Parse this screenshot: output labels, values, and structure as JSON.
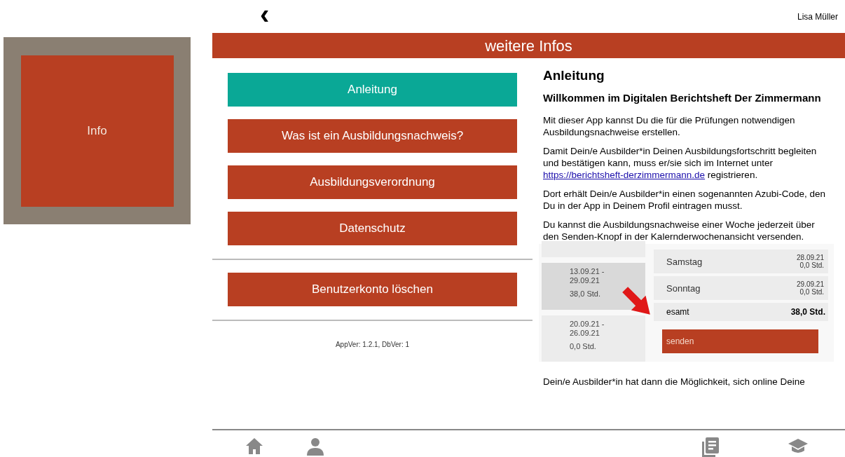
{
  "tile": {
    "label": "Info"
  },
  "top_bar": {
    "back": "‹",
    "user": "Lisa Müller"
  },
  "header": {
    "title": "weitere Infos"
  },
  "menu": [
    {
      "label": "Anleitung",
      "selected": true
    },
    {
      "label": "Was ist ein Ausbildungsnachweis?",
      "selected": false
    },
    {
      "label": "Ausbildungsverordnung",
      "selected": false
    },
    {
      "label": "Datenschutz",
      "selected": false
    }
  ],
  "delete_button": "Benutzerkonto löschen",
  "version": "AppVer: 1.2.1, DbVer: 1",
  "article": {
    "title": "Anleitung",
    "subtitle": "Willkommen im Digitalen Berichtsheft Der Zimmermann",
    "paragraphs": [
      {
        "text": "Mit dieser App kannst Du die für die Prüfungen notwendigen Ausbildungsnachweise erstellen."
      },
      {
        "text": "Damit Dein/e Ausbilder*in Deinen Ausbildungsfortschritt begleiten und bestätigen kann, muss er/sie sich im Internet unter",
        "link": "https://berichtsheft-derzimmermann.de",
        "after": "registrieren."
      },
      {
        "text": "Dort erhält Dein/e Ausbilder*in einen sogenannten Azubi-Code, den Du in der App in Deinem Profil eintragen musst."
      },
      {
        "text": "Du kannst die Ausbildungsnachweise einer Woche jederzeit über den Senden-Knopf in der Kalernderwochenansicht versenden."
      }
    ],
    "example": {
      "weeks": [
        {
          "selected": false
        },
        {
          "range": "13.09.21 - 29.09.21",
          "hours": "38,0 Std.",
          "selected": true
        },
        {
          "range": "20.09.21 - 26.09.21",
          "hours": "0,0 Std.",
          "selected": false
        }
      ],
      "days": [
        {
          "day": "Samstag",
          "date": "28.09.21",
          "hours": "0,0 Std."
        },
        {
          "day": "Sonntag",
          "date": "29.09.21",
          "hours": "0,0 Std."
        }
      ],
      "total_label": "esamt",
      "total": "38,0 Std.",
      "send": "senden"
    },
    "closing": "Dein/e Ausbilder*in hat dann die Möglichkeit, sich online Deine"
  }
}
